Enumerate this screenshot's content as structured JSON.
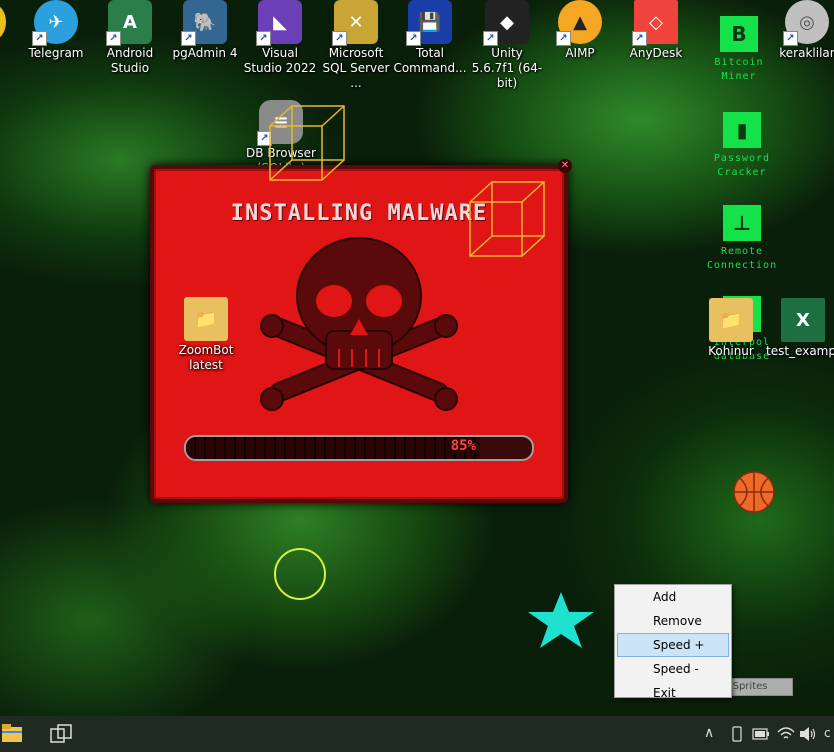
{
  "desktop_icons": [
    {
      "name": "telegram",
      "label": "Telegram",
      "color": "#2aa1de",
      "glyph": "✈"
    },
    {
      "name": "android-studio",
      "label": "Android Studio",
      "color": "#3ddc84",
      "glyph": "A"
    },
    {
      "name": "pgadmin",
      "label": "pgAdmin 4",
      "color": "#336791",
      "glyph": "🐘"
    },
    {
      "name": "visual-studio",
      "label": "Visual Studio 2022",
      "color": "#6b3fb5",
      "glyph": "◣"
    },
    {
      "name": "sql-server",
      "label": "Microsoft SQL Server ...",
      "color": "#c8a535",
      "glyph": "✕"
    },
    {
      "name": "total-commander",
      "label": "Total Command...",
      "color": "#1a3ea8",
      "glyph": "💾"
    },
    {
      "name": "unity",
      "label": "Unity 5.6.7f1 (64-bit)",
      "color": "#222222",
      "glyph": "◆"
    },
    {
      "name": "aimp",
      "label": "AIMP",
      "color": "#f5a623",
      "glyph": "▲"
    },
    {
      "name": "anydesk",
      "label": "AnyDesk",
      "color": "#ef443b",
      "glyph": "◇"
    },
    {
      "name": "keraklilar",
      "label": "keraklilar",
      "color": "#c0c0c0",
      "glyph": "◎"
    },
    {
      "name": "db-browser",
      "label": "DB Browser (SQLite)",
      "color": "#8a8a8a",
      "glyph": "≡"
    },
    {
      "name": "zoombot",
      "label": "ZoomBot latest",
      "color": "#e8c060",
      "glyph": "📁"
    },
    {
      "name": "kohinur",
      "label": "Kohinur",
      "color": "#e8c060",
      "glyph": "📁"
    },
    {
      "name": "test-example",
      "label": "test_examp...",
      "color": "#1d6f42",
      "glyph": "X"
    }
  ],
  "hacker_icons": [
    {
      "label": "Bitcoin Miner",
      "glyph": "B"
    },
    {
      "label": "Password Cracker",
      "glyph": "▮"
    },
    {
      "label": "Remote Connection",
      "glyph": "⊥"
    },
    {
      "label": "Interpol database",
      "glyph": "→"
    }
  ],
  "malware_window": {
    "title": "INSTALLING MALWARE",
    "percent_label": "85%",
    "progress": 0.85
  },
  "context_menu": {
    "items": [
      "Add",
      "Remove",
      "Speed +",
      "Speed -",
      "Exit"
    ],
    "highlighted_index": 2
  },
  "tray_tooltip": "Speed 1  |  Sprites",
  "colors": {
    "popup_red": "#e01515",
    "matrix_green": "#13e24a",
    "star": "#20e0d0",
    "circle": "#d8f040",
    "cube": "#e8b830"
  }
}
